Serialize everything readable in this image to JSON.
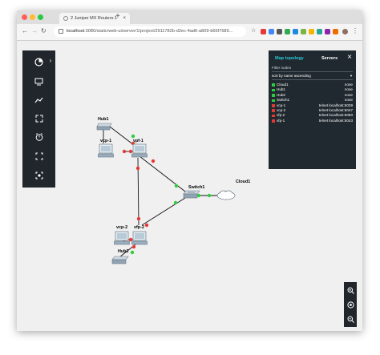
{
  "browser": {
    "tab_title": "2 Juniper MX Routers-1",
    "tab_close": "×",
    "new_tab": "+",
    "url_host": "localhost",
    "url_rest": ":3080/static/web-ui/server/1/project/2911782b-d2ec-4ad6-a809-b66f7689..."
  },
  "toolbar": {
    "items": [
      "nodes-library-icon",
      "add-console-icon",
      "draw-link-icon",
      "fullscreen-icon",
      "snapshot-icon",
      "fit-to-screen-icon",
      "screenshot-icon"
    ],
    "expand": "›"
  },
  "panel": {
    "tab_map": "Map topology",
    "tab_servers": "Servers",
    "close": "×",
    "filter_placeholder": "Filter nodes",
    "sort_value": "sort by name ascending",
    "nodes": [
      {
        "name": "Cloud1",
        "console": "none",
        "status": "started"
      },
      {
        "name": "Hub1",
        "console": "none",
        "status": "started"
      },
      {
        "name": "Hub2",
        "console": "none",
        "status": "started"
      },
      {
        "name": "Switch1",
        "console": "none",
        "status": "started"
      },
      {
        "name": "vcp-1",
        "console": "telnet localhost:5039",
        "status": "stopped"
      },
      {
        "name": "vcp-2",
        "console": "telnet localhost:5047",
        "status": "stopped"
      },
      {
        "name": "vfp-2",
        "console": "telnet localhost:5050",
        "status": "stopped"
      },
      {
        "name": "vfp-1",
        "console": "telnet localhost:5043",
        "status": "stopped"
      }
    ]
  },
  "topology": {
    "labels": {
      "hub1": "Hub1",
      "vcp1": "vcp-1",
      "vfp1": "vpf-1",
      "switch1": "Switch1",
      "cloud1": "Cloud1",
      "vcp2": "vcp-2",
      "vfp2": "vfp-2",
      "hub2": "Hub2"
    }
  },
  "zoom": {
    "items": [
      "zoom-in-icon",
      "reset-zoom-icon",
      "zoom-out-icon"
    ]
  },
  "colors": {
    "started": "#2ecc40",
    "stopped": "#e53935",
    "toolbar_bg": "#20262b",
    "panel_bg": "#20292f",
    "accent": "#26c6da"
  }
}
